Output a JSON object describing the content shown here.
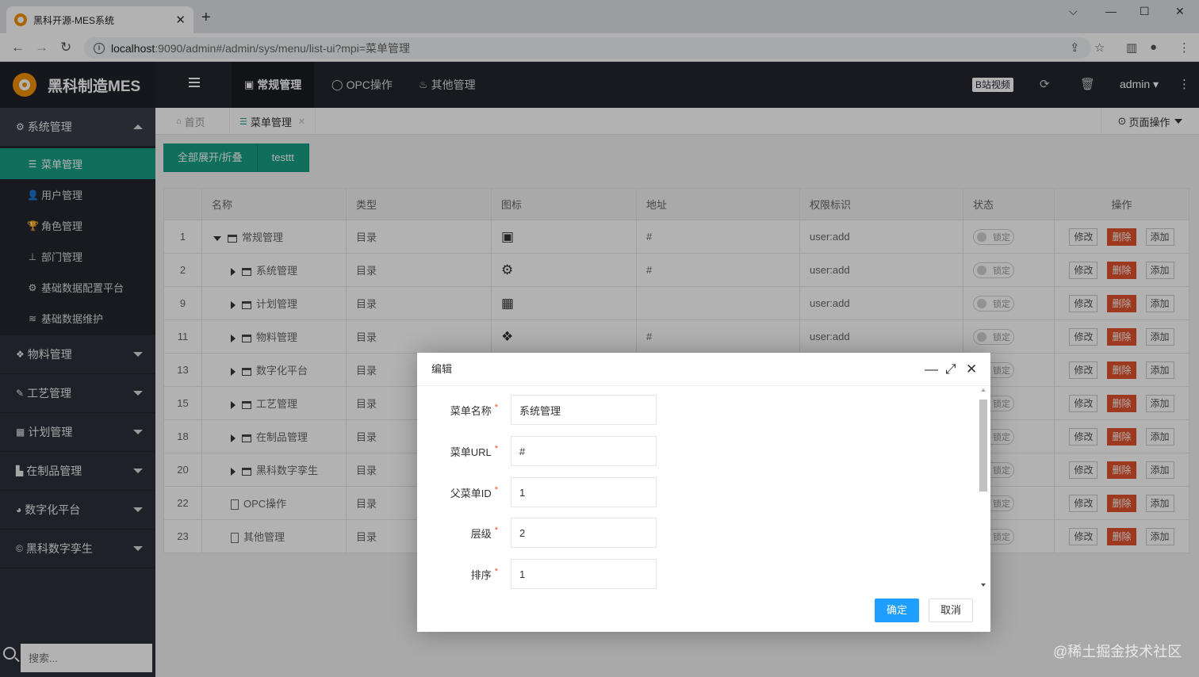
{
  "browser": {
    "tab_title": "黑科开源-MES系统",
    "url_host": "localhost",
    "url_rest": ":9090/admin#/admin/sys/menu/list-ui?mpi=菜单管理"
  },
  "header": {
    "logo_text": "黑科制造MES",
    "nav": [
      {
        "label": "常规管理",
        "icon": "address-card-icon"
      },
      {
        "label": "OPC操作",
        "icon": "circle-icon"
      },
      {
        "label": "其他管理",
        "icon": "cup-icon"
      }
    ],
    "bili_label": "B站视频",
    "user": "admin"
  },
  "sidebar": {
    "groups": [
      {
        "label": "系统管理",
        "icon": "gears-icon",
        "open": true
      },
      {
        "label": "物料管理",
        "icon": "cubes-icon"
      },
      {
        "label": "工艺管理",
        "icon": "wrench-icon"
      },
      {
        "label": "计划管理",
        "icon": "calendar-icon"
      },
      {
        "label": "在制品管理",
        "icon": "bar-chart-icon"
      },
      {
        "label": "数字化平台",
        "icon": "pie-chart-icon"
      },
      {
        "label": "黑科数字孪生",
        "icon": "copyright-icon"
      }
    ],
    "items": [
      {
        "label": "菜单管理",
        "icon": "list-icon",
        "active": true
      },
      {
        "label": "用户管理",
        "icon": "user-icon"
      },
      {
        "label": "角色管理",
        "icon": "trophy-icon"
      },
      {
        "label": "部门管理",
        "icon": "sitemap-icon"
      },
      {
        "label": "基础数据配置平台",
        "icon": "gear-icon"
      },
      {
        "label": "基础数据维护",
        "icon": "database-icon"
      }
    ],
    "search_placeholder": "搜索..."
  },
  "page_tabs": {
    "home": "首页",
    "current": "菜单管理",
    "page_ops": "页面操作"
  },
  "toolbar": {
    "expand_label": "全部展开/折叠",
    "test_label": "testtt"
  },
  "table": {
    "headers": [
      "",
      "名称",
      "类型",
      "图标",
      "地址",
      "权限标识",
      "状态",
      "操作"
    ],
    "rows": [
      {
        "id": "1",
        "name": "常规管理",
        "type": "目录",
        "icon": "address-card-icon",
        "addr": "#",
        "perm": "user:add",
        "status": "锁定"
      },
      {
        "id": "2",
        "name": "系统管理",
        "type": "目录",
        "icon": "gears-icon",
        "addr": "#",
        "perm": "user:add",
        "status": "锁定"
      },
      {
        "id": "9",
        "name": "计划管理",
        "type": "目录",
        "icon": "calendar-icon",
        "addr": "",
        "perm": "user:add",
        "status": "锁定"
      },
      {
        "id": "11",
        "name": "物料管理",
        "type": "目录",
        "icon": "cubes-icon",
        "addr": "#",
        "perm": "user:add",
        "status": "锁定"
      },
      {
        "id": "13",
        "name": "数字化平台",
        "type": "目录",
        "icon": "",
        "addr": "",
        "perm": "",
        "status": "锁定"
      },
      {
        "id": "15",
        "name": "工艺管理",
        "type": "目录",
        "icon": "",
        "addr": "",
        "perm": "",
        "status": "锁定"
      },
      {
        "id": "18",
        "name": "在制品管理",
        "type": "目录",
        "icon": "",
        "addr": "",
        "perm": "",
        "status": "锁定"
      },
      {
        "id": "20",
        "name": "黑科数字孪生",
        "type": "目录",
        "icon": "",
        "addr": "",
        "perm": "",
        "status": "锁定"
      },
      {
        "id": "22",
        "name": "OPC操作",
        "type": "目录",
        "icon": "",
        "addr": "",
        "perm": "",
        "status": "锁定"
      },
      {
        "id": "23",
        "name": "其他管理",
        "type": "目录",
        "icon": "",
        "addr": "",
        "perm": "",
        "status": "锁定"
      }
    ],
    "actions": {
      "edit": "修改",
      "delete": "删除",
      "add": "添加"
    }
  },
  "modal": {
    "title": "编辑",
    "fields": [
      {
        "label": "菜单名称",
        "value": "系统管理"
      },
      {
        "label": "菜单URL",
        "value": "#"
      },
      {
        "label": "父菜单ID",
        "value": "1"
      },
      {
        "label": "层级",
        "value": "2"
      },
      {
        "label": "排序",
        "value": "1"
      }
    ],
    "ok_label": "确定",
    "cancel_label": "取消"
  },
  "watermark": "@稀土掘金技术社区",
  "colors": {
    "accent": "#16a085",
    "danger": "#e0522d",
    "primary": "#1e9fff",
    "header": "#23262e"
  }
}
